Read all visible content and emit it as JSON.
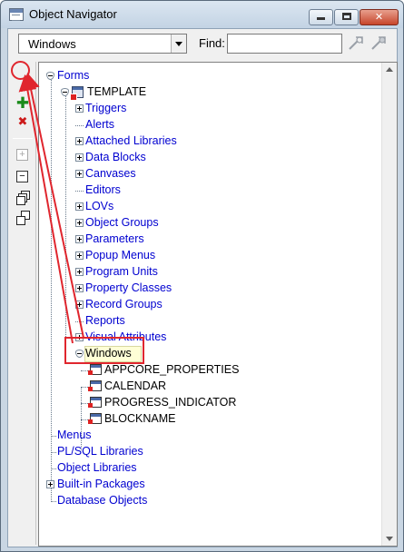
{
  "window": {
    "title": "Object Navigator",
    "minimize_label": "minimize",
    "maximize_label": "maximize",
    "close_label": "✕"
  },
  "toolbar": {
    "select_value": "Windows",
    "find_label": "Find:",
    "find_value": ""
  },
  "side_tools": {
    "create": "✚",
    "delete": "✖",
    "expand": "+",
    "collapse": "−"
  },
  "tree": {
    "root": "Forms",
    "module": "TEMPLATE",
    "categories": [
      "Triggers",
      "Alerts",
      "Attached Libraries",
      "Data Blocks",
      "Canvases",
      "Editors",
      "LOVs",
      "Object Groups",
      "Parameters",
      "Popup Menus",
      "Program Units",
      "Property Classes",
      "Record Groups",
      "Reports",
      "Visual Attributes",
      "Windows"
    ],
    "windows": [
      "APPCORE_PROPERTIES",
      "CALENDAR",
      "PROGRESS_INDICATOR",
      "BLOCKNAME"
    ],
    "top_level": [
      "Menus",
      "PL/SQL Libraries",
      "Object Libraries",
      "Built-in Packages",
      "Database Objects"
    ]
  },
  "colors": {
    "annotation": "#e0262e",
    "link_text": "#0000d0",
    "highlight": "#ffffd6"
  }
}
